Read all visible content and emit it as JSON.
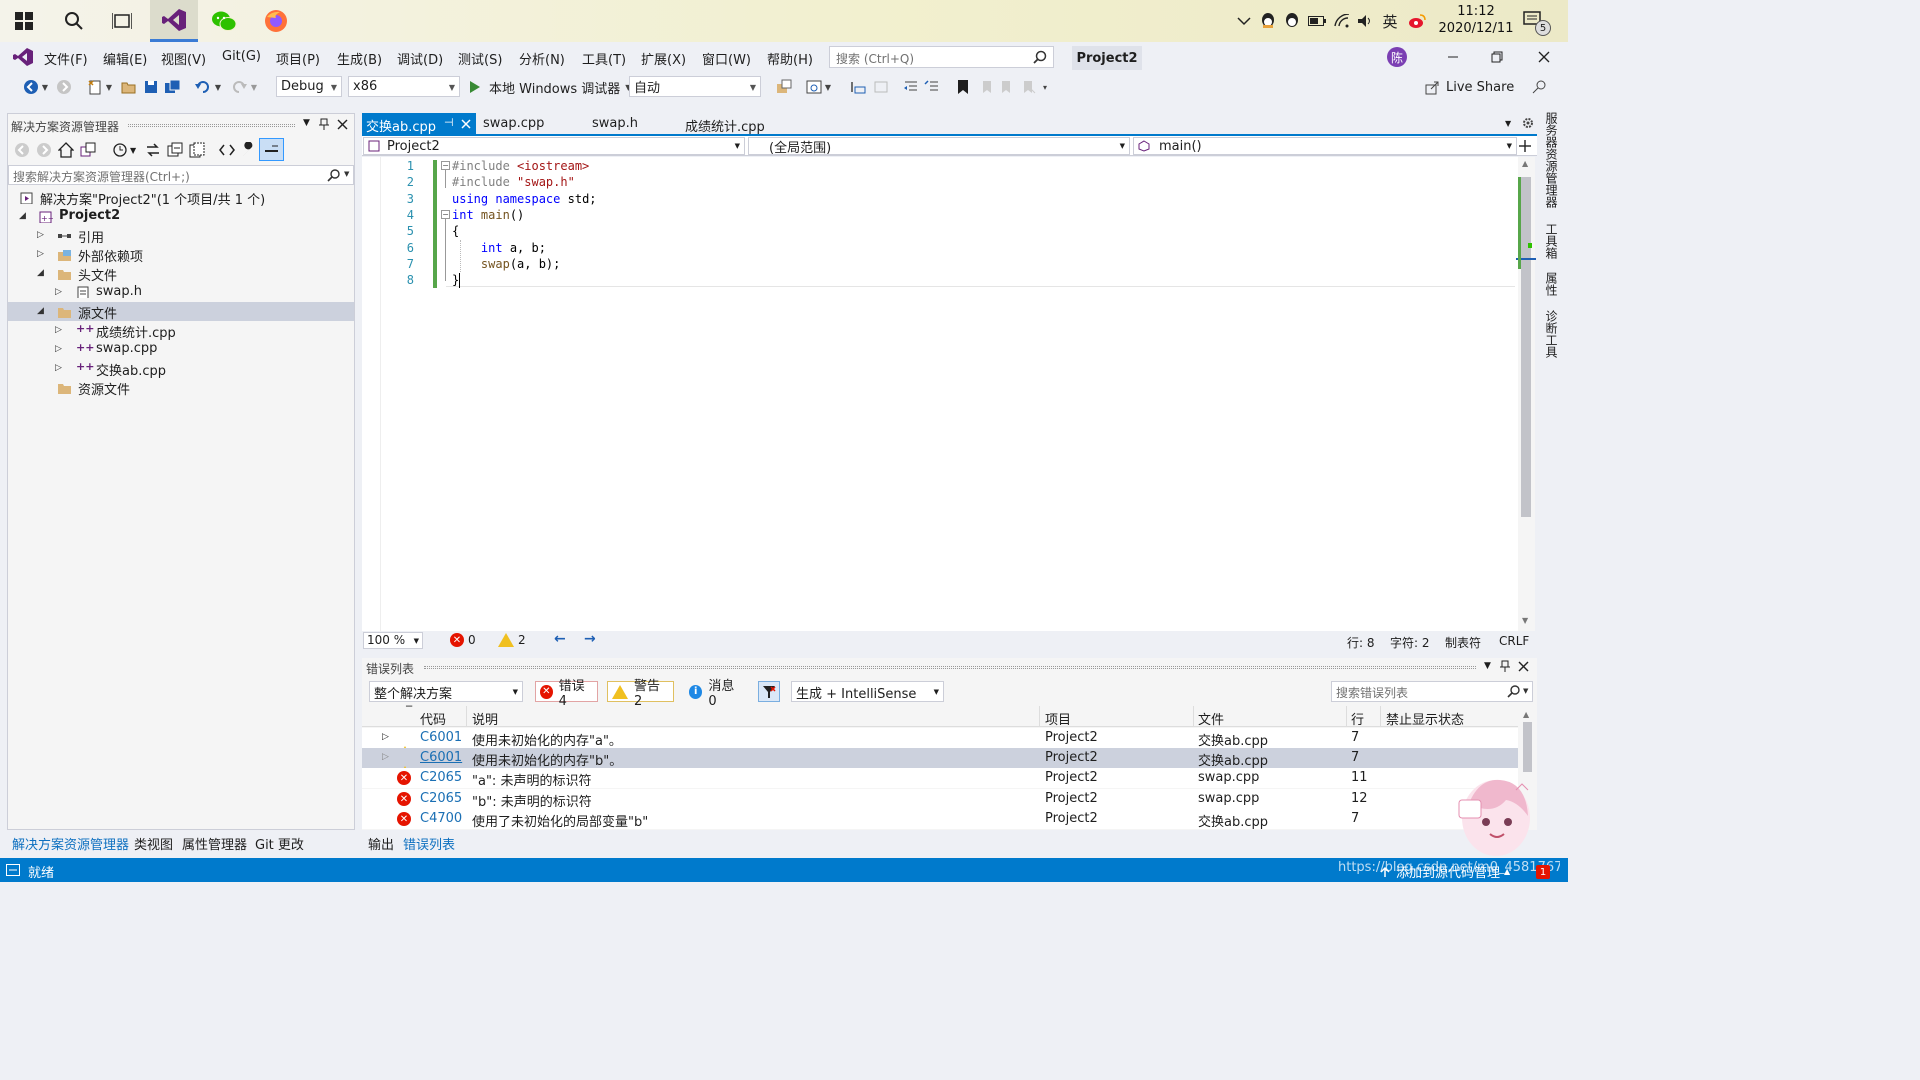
{
  "taskbar": {
    "clock_time": "11:12",
    "clock_date": "2020/12/11",
    "notification_count": "5",
    "ime_label": "英"
  },
  "menu": {
    "items": [
      "文件(F)",
      "编辑(E)",
      "视图(V)",
      "Git(G)",
      "项目(P)",
      "生成(B)",
      "调试(D)",
      "测试(S)",
      "分析(N)",
      "工具(T)",
      "扩展(X)",
      "窗口(W)",
      "帮助(H)"
    ],
    "search_placeholder": "搜索 (Ctrl+Q)",
    "project_title": "Project2",
    "user_avatar": "陈"
  },
  "toolbar": {
    "config": "Debug",
    "platform": "x86",
    "debugger": "本地 Windows 调试器",
    "auto": "自动",
    "live_share": "Live Share"
  },
  "solution_explorer": {
    "title": "解决方案资源管理器",
    "search_placeholder": "搜索解决方案资源管理器(Ctrl+;)",
    "tree": [
      {
        "label": "解决方案\"Project2\"(1 个项目/共 1 个)"
      },
      {
        "label": "Project2"
      },
      {
        "label": "引用"
      },
      {
        "label": "外部依赖项"
      },
      {
        "label": "头文件"
      },
      {
        "label": "swap.h"
      },
      {
        "label": "源文件"
      },
      {
        "label": "成绩统计.cpp"
      },
      {
        "label": "swap.cpp"
      },
      {
        "label": "交换ab.cpp"
      },
      {
        "label": "资源文件"
      }
    ],
    "bottom_tabs": [
      "解决方案资源管理器",
      "类视图",
      "属性管理器",
      "Git 更改"
    ]
  },
  "editor": {
    "tabs": [
      "交换ab.cpp",
      "swap.cpp",
      "swap.h",
      "成绩统计.cpp"
    ],
    "nav_project": "Project2",
    "nav_scope": "(全局范围)",
    "nav_member": "main()",
    "line_numbers": [
      "1",
      "2",
      "3",
      "4",
      "5",
      "6",
      "7",
      "8"
    ],
    "zoom": "100 %",
    "error_count": "0",
    "warning_count": "2",
    "cursor_line": "行: 8",
    "cursor_col": "字符: 2",
    "indent_mode": "制表符",
    "line_ending": "CRLF"
  },
  "error_list": {
    "title": "错误列表",
    "scope": "整个解决方案",
    "errors_chip": "错误 4",
    "warnings_chip": "警告 2",
    "messages_chip": "消息 0",
    "build_filter": "生成 + IntelliSense",
    "search_placeholder": "搜索错误列表",
    "headers": {
      "code": "代码",
      "description": "说明",
      "project": "项目",
      "file": "文件",
      "line": "行",
      "suppression": "禁止显示状态"
    },
    "rows": [
      {
        "type": "warning",
        "code": "C6001",
        "description": "使用未初始化的内存\"a\"。",
        "project": "Project2",
        "file": "交换ab.cpp",
        "line": "7"
      },
      {
        "type": "warning",
        "code": "C6001",
        "description": "使用未初始化的内存\"b\"。",
        "project": "Project2",
        "file": "交换ab.cpp",
        "line": "7"
      },
      {
        "type": "error",
        "code": "C2065",
        "description": "\"a\": 未声明的标识符",
        "project": "Project2",
        "file": "swap.cpp",
        "line": "11"
      },
      {
        "type": "error",
        "code": "C2065",
        "description": "\"b\": 未声明的标识符",
        "project": "Project2",
        "file": "swap.cpp",
        "line": "12"
      },
      {
        "type": "error",
        "code": "C4700",
        "description": "使用了未初始化的局部变量\"b\"",
        "project": "Project2",
        "file": "交换ab.cpp",
        "line": "7"
      }
    ],
    "bottom_tabs": [
      "输出",
      "错误列表"
    ]
  },
  "statusbar": {
    "ready": "就绪",
    "source_control": "添加到源代码管理",
    "watermark": "https://blog.csdn.net/m0_45817672"
  },
  "right_strip": [
    "服务器资源管理器",
    "工具箱",
    "属性",
    "诊断工具"
  ],
  "colors": {
    "accent": "#007acc",
    "vs_purple": "#68217a",
    "error": "#e51400",
    "warning": "#f0c020"
  }
}
